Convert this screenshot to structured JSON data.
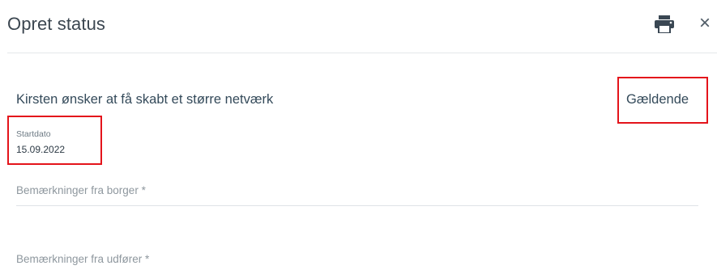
{
  "header": {
    "title": "Opret status",
    "print_icon": "printer-icon",
    "close_icon": "close-icon",
    "close_glyph": "×"
  },
  "goal": {
    "text": "Kirsten ønsker at få skabt et større netværk",
    "status": "Gældende"
  },
  "start_date": {
    "label": "Startdato",
    "value": "15.09.2022"
  },
  "fields": {
    "borger_label": "Bemærkninger fra borger *",
    "udforer_label": "Bemærkninger fra udfører *"
  },
  "colors": {
    "highlight": "#e4141b",
    "text": "#344a5a",
    "divider": "#e4e7ea"
  }
}
